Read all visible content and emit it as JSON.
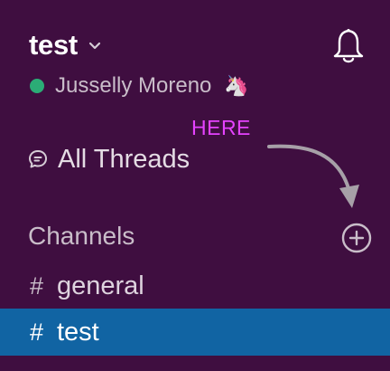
{
  "workspace": {
    "name": "test",
    "chevron_icon": "chevron-down-icon",
    "bell_icon": "bell-icon"
  },
  "user": {
    "name": "Jusselly Moreno",
    "status_emoji": "🦄",
    "presence_color": "#2bac76"
  },
  "annotation": {
    "text": "HERE",
    "color": "#e542ff"
  },
  "nav": {
    "threads_label": "All Threads",
    "threads_icon": "threads-icon"
  },
  "channels": {
    "header": "Channels",
    "add_icon": "plus-circle-icon",
    "items": [
      {
        "prefix": "#",
        "name": "general",
        "selected": false
      },
      {
        "prefix": "#",
        "name": "test",
        "selected": true
      }
    ]
  },
  "colors": {
    "sidebar_bg": "#3f0e40",
    "selected_bg": "#1164a3"
  }
}
